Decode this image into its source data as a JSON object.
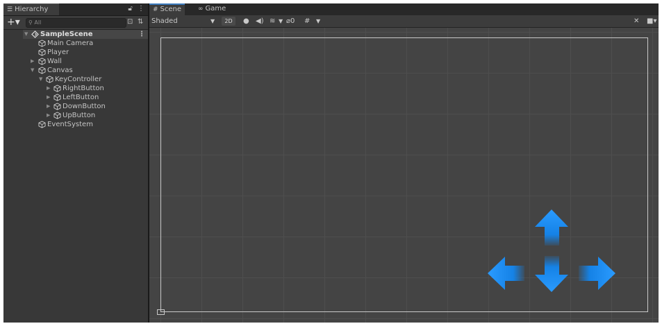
{
  "hierarchy": {
    "tab_title": "Hierarchy",
    "add_label": "+▾",
    "search_placeholder": "All",
    "scene": "SampleScene",
    "items": [
      {
        "label": "Main Camera",
        "expander": ""
      },
      {
        "label": "Player",
        "expander": ""
      },
      {
        "label": "Wall",
        "expander": "▶"
      },
      {
        "label": "Canvas",
        "expander": "▼"
      },
      {
        "label": "KeyController",
        "expander": "▼"
      },
      {
        "label": "RightButton",
        "expander": "▶"
      },
      {
        "label": "LeftButton",
        "expander": "▶"
      },
      {
        "label": "DownButton",
        "expander": "▶"
      },
      {
        "label": "UpButton",
        "expander": "▶"
      },
      {
        "label": "EventSystem",
        "expander": ""
      }
    ]
  },
  "scene_view": {
    "tabs": [
      {
        "label": "Scene",
        "icon": "grid-icon",
        "active": true
      },
      {
        "label": "Game",
        "icon": "gamepad-icon",
        "active": false
      }
    ],
    "draw_mode": "Shaded",
    "btn_2d": "2D",
    "hidden_count": "0"
  },
  "colors": {
    "arrow_blue": "#1a8df0",
    "selection_blue": "#3a79bb"
  }
}
